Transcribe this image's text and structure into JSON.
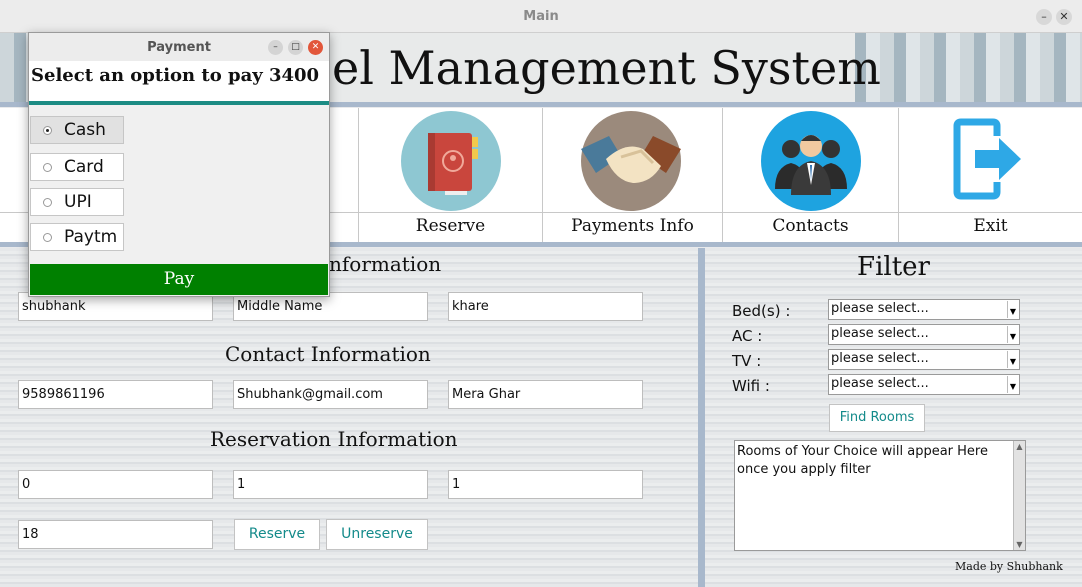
{
  "main_window": {
    "title": "Main",
    "minimize_glyph": "–",
    "close_glyph": "✕",
    "header_title": "el Management System"
  },
  "nav": {
    "items": [
      {
        "label": "Reserve",
        "icon": "reserve-book-icon"
      },
      {
        "label": "Payments Info",
        "icon": "handshake-icon"
      },
      {
        "label": "Contacts",
        "icon": "contacts-people-icon"
      },
      {
        "label": "Exit",
        "icon": "exit-arrow-icon"
      }
    ]
  },
  "personal": {
    "section_title": "nformation",
    "first_name": "shubhank",
    "middle_name": "Middle Name",
    "last_name": "khare"
  },
  "contact": {
    "section_title": "Contact Information",
    "phone": "9589861196",
    "email": "Shubhank@gmail.com",
    "address": "Mera Ghar"
  },
  "reservation": {
    "section_title": "Reservation Information",
    "field1": "0",
    "field2": "1",
    "field3": "1",
    "field4": "18",
    "reserve_label": "Reserve",
    "unreserve_label": "Unreserve"
  },
  "filter": {
    "title": "Filter",
    "beds_label": "Bed(s) :",
    "ac_label": "AC :",
    "tv_label": "TV :",
    "wifi_label": "Wifi :",
    "beds_value": "please select...",
    "ac_value": "please select...",
    "tv_value": "please select...",
    "wifi_value": "please select...",
    "find_label": "Find Rooms",
    "results_text": "Rooms of Your Choice will appear Here\nonce you apply filter",
    "credit": "Made by Shubhank"
  },
  "payment_dialog": {
    "title": "Payment",
    "prompt": "Select an option to pay 3400",
    "options": [
      {
        "label": "Cash",
        "selected": true
      },
      {
        "label": "Card",
        "selected": false
      },
      {
        "label": "UPI",
        "selected": false
      },
      {
        "label": "Paytm",
        "selected": false
      }
    ],
    "pay_label": "Pay"
  },
  "colors": {
    "pay_button": "#008000",
    "accent_rule": "#1c8c84",
    "button_text": "#138a8a",
    "separator": "#a8b8cc"
  }
}
